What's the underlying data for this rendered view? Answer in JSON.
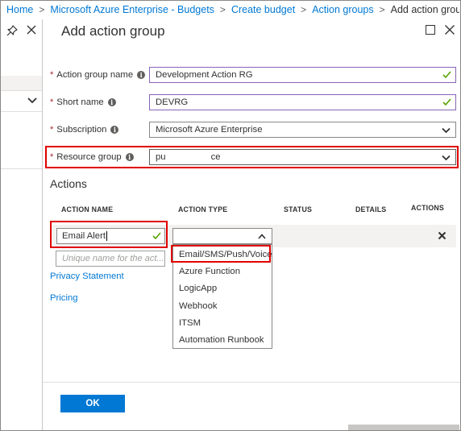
{
  "breadcrumb": [
    {
      "label": "Home"
    },
    {
      "label": "Microsoft Azure Enterprise - Budgets"
    },
    {
      "label": "Create budget"
    },
    {
      "label": "Action groups"
    }
  ],
  "breadcrumb_current": "Add action group",
  "blade": {
    "title": "Add action group"
  },
  "form": {
    "action_group_name": {
      "label": "Action group name",
      "value": "Development Action RG"
    },
    "short_name": {
      "label": "Short name",
      "value": "DEVRG"
    },
    "subscription": {
      "label": "Subscription",
      "value": "Microsoft Azure Enterprise"
    },
    "resource_group": {
      "label": "Resource group",
      "value_start": "pu",
      "value_end": "ce"
    }
  },
  "actions": {
    "section_title": "Actions",
    "columns": [
      "ACTION NAME",
      "ACTION TYPE",
      "STATUS",
      "DETAILS",
      "ACTIONS"
    ],
    "row": {
      "name": "Email Alert"
    },
    "new_row_placeholder": "Unique name for the act...",
    "type_options": [
      "Email/SMS/Push/Voice",
      "Azure Function",
      "LogicApp",
      "Webhook",
      "ITSM",
      "Automation Runbook"
    ]
  },
  "links": {
    "privacy": "Privacy Statement",
    "pricing": "Pricing"
  },
  "footer": {
    "ok_label": "OK"
  },
  "colors": {
    "accent": "#0078d4",
    "highlight": "#e00000",
    "valid": "#57a300",
    "focus_border": "#8764b8"
  },
  "icons": {
    "pin": "pin-icon",
    "close": "close-icon",
    "maximize": "maximize-icon",
    "info": "info-icon",
    "check": "check-icon",
    "chevron": "chevron-down-icon",
    "delete": "delete-icon"
  }
}
